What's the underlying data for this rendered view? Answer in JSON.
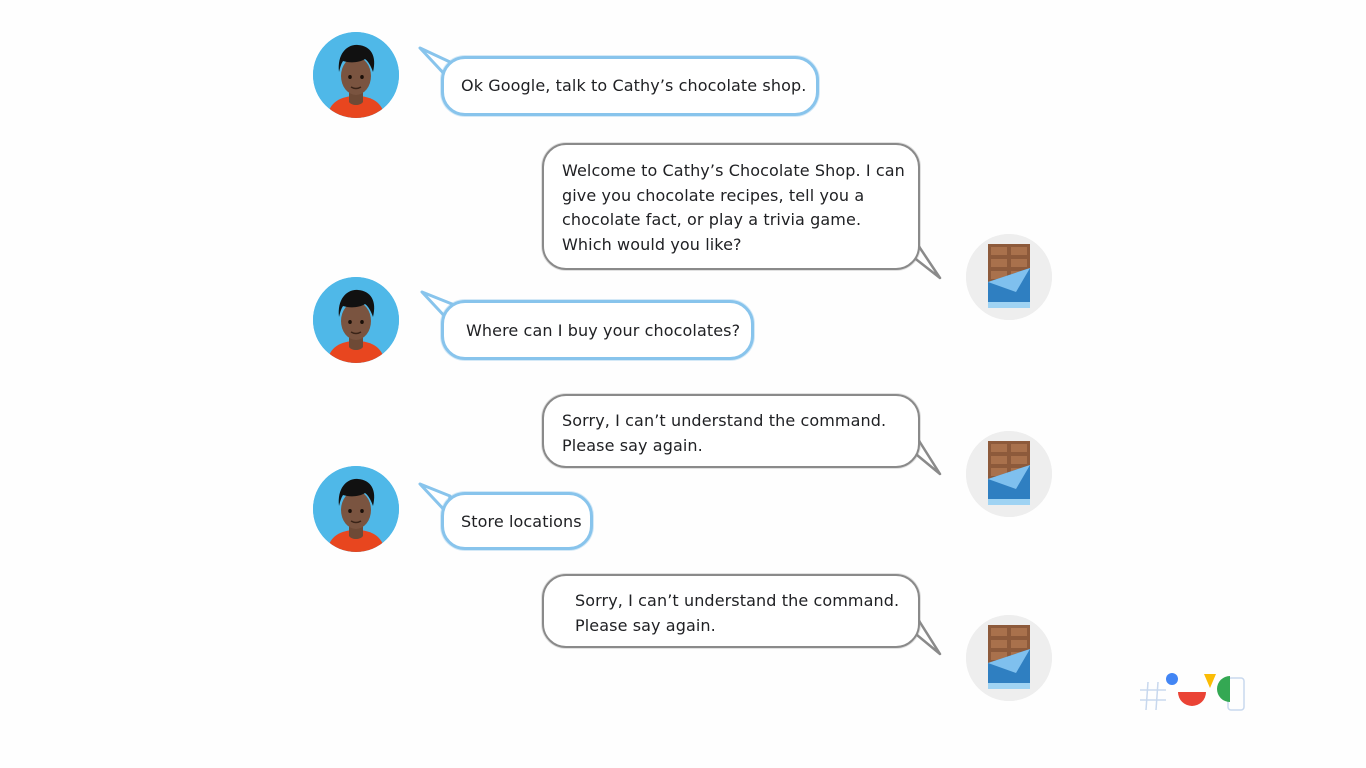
{
  "conversation": {
    "messages": [
      {
        "speaker": "user",
        "text": "Ok Google, talk to Cathy’s chocolate shop."
      },
      {
        "speaker": "bot",
        "text": "Welcome to Cathy’s Chocolate Shop. I can give you chocolate recipes, tell you a chocolate fact, or play a trivia game. Which would you like?"
      },
      {
        "speaker": "user",
        "text": "Where can I buy your chocolates?"
      },
      {
        "speaker": "bot",
        "text": "Sorry, I can’t understand the command. Please say again."
      },
      {
        "speaker": "user",
        "text": "Store locations"
      },
      {
        "speaker": "bot",
        "text": "Sorry, I can’t understand the command. Please say again."
      }
    ]
  },
  "colors": {
    "user_bubble_border": "#88c4ec",
    "bot_bubble_border": "#8a8a8a",
    "user_avatar_bg": "#4fb8e8",
    "bot_avatar_bg": "#eeeeee",
    "chocolate": "#8d5a3b",
    "wrapper": "#2f7fc1"
  },
  "icons": {
    "user_avatar": "person-avatar-icon",
    "bot_avatar": "chocolate-bar-icon",
    "event_logo": "google-io-logo-icon"
  }
}
